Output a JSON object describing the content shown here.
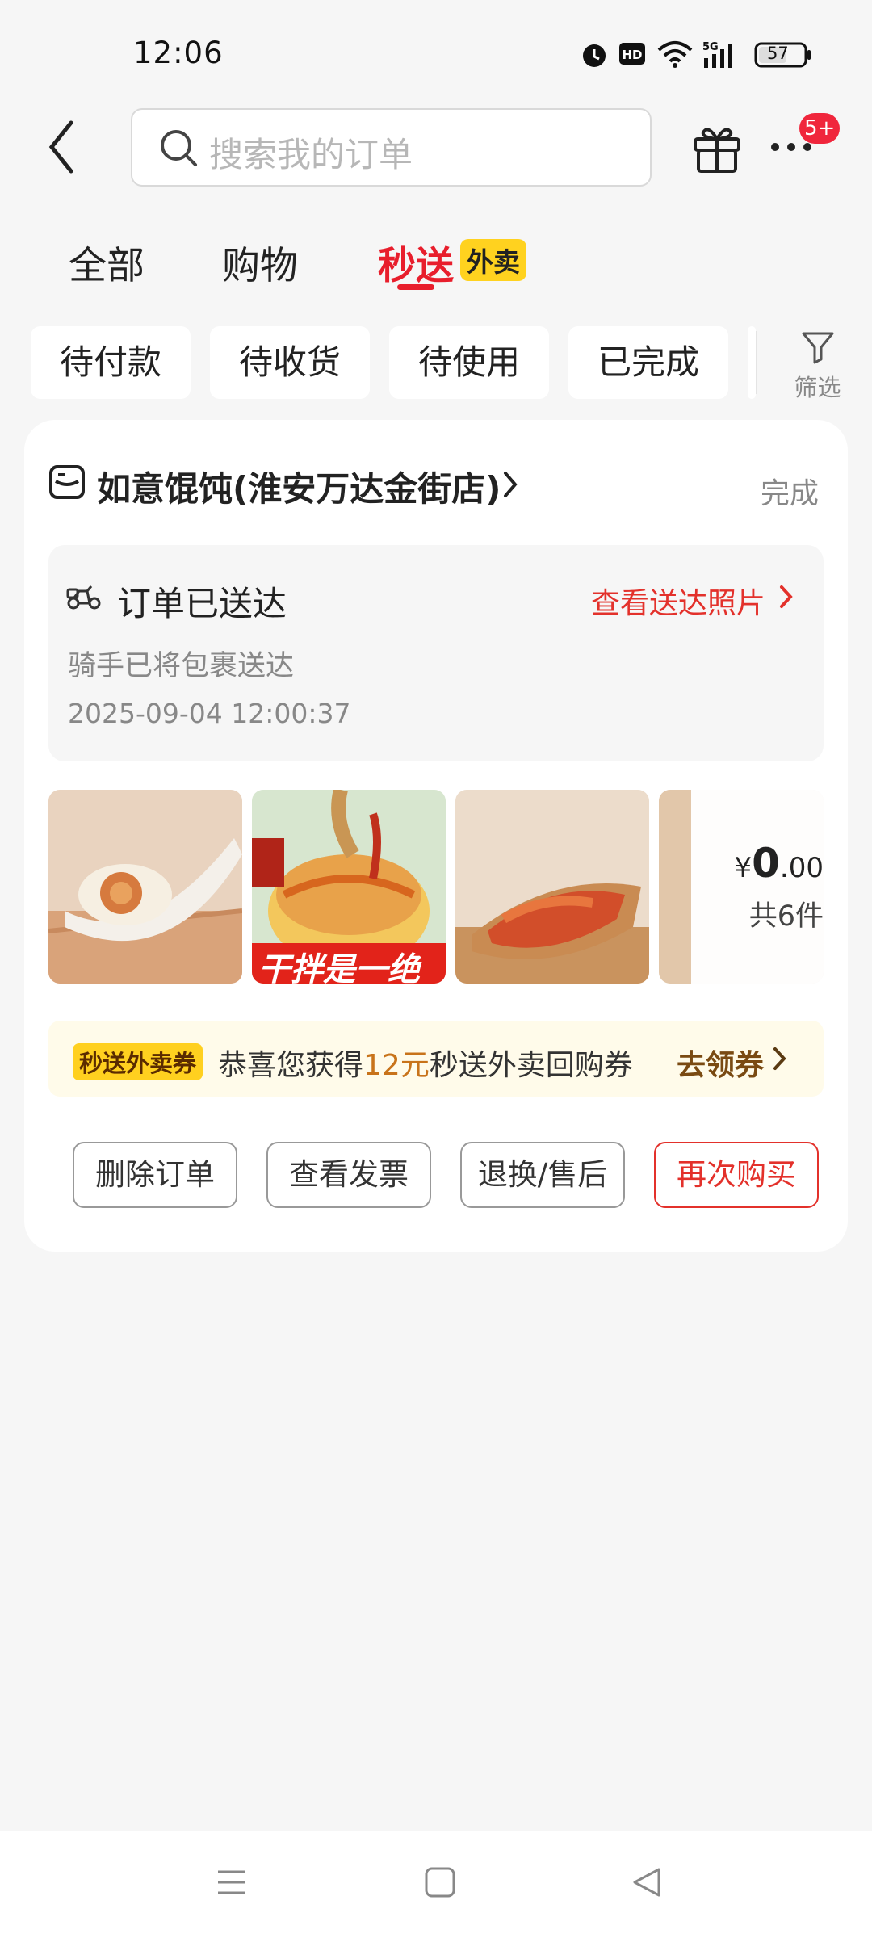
{
  "status_bar": {
    "time": "12:06",
    "network": "5G",
    "battery": "57",
    "icons": [
      "alarm-icon",
      "hd-icon",
      "wifi-icon",
      "signal-icon",
      "battery-icon"
    ]
  },
  "header": {
    "search_placeholder": "搜索我的订单",
    "more_badge": "5+"
  },
  "tabs": [
    {
      "label": "全部"
    },
    {
      "label": "购物"
    },
    {
      "label": "秒送",
      "tag": "外卖",
      "active": true
    }
  ],
  "filters": {
    "chips": [
      "待付款",
      "待收货",
      "待使用",
      "已完成"
    ],
    "filter_label": "筛选"
  },
  "order": {
    "store_name": "如意馄饨(淮安万达金街店)",
    "status": "完成",
    "delivery": {
      "title": "订单已送达",
      "photo_link": "查看送达照片",
      "desc": "骑手已将包裹送达",
      "time": "2025-09-04 12:00:37"
    },
    "thumb_caption": "干拌是一绝",
    "price_symbol": "¥",
    "price_int": "0",
    "price_dec": ".00",
    "count_text": "共6件",
    "coupon": {
      "tag": "秒送外卖券",
      "text_before": "恭喜您获得",
      "amount": "12元",
      "text_after": "秒送外卖回购券",
      "action": "去领券"
    },
    "actions": {
      "delete": "删除订单",
      "invoice": "查看发票",
      "refund": "退换/售后",
      "rebuy": "再次购买"
    }
  },
  "colors": {
    "accent": "#e81e2c",
    "tag_yellow": "#ffd21f",
    "coupon_bg": "#fffbea"
  }
}
